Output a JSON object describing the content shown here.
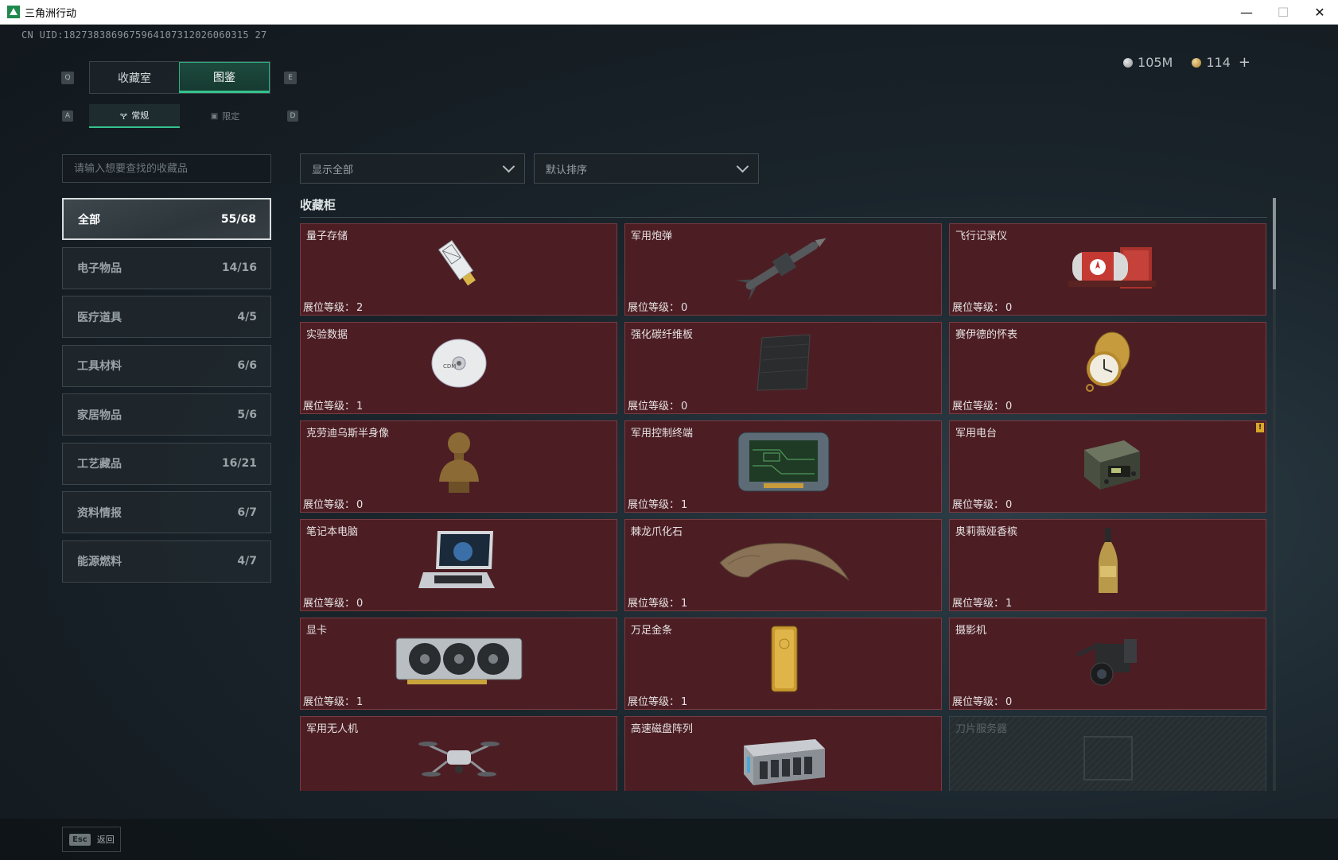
{
  "window": {
    "title": "三角洲行动",
    "controls": {
      "minimize": "—",
      "maximize": "☐",
      "close": "✕"
    }
  },
  "uid": "CN UID:1827383869675964107312026060315 27",
  "currency": [
    {
      "icon": "silver-coin-icon",
      "value": "105M"
    },
    {
      "icon": "gold-coin-icon",
      "value": "114"
    }
  ],
  "currency_add": "+",
  "keys": {
    "prev_tab": "Q",
    "next_tab": "E",
    "prev_sub": "A",
    "next_sub": "D"
  },
  "tabs": [
    {
      "label": "收藏室",
      "active": false
    },
    {
      "label": "图鉴",
      "active": true
    }
  ],
  "subtabs": [
    {
      "label": "常规",
      "icon": "bottle-icon",
      "active": true
    },
    {
      "label": "限定",
      "icon": "frame-icon",
      "active": false
    }
  ],
  "search": {
    "placeholder": "请输入想要查找的收藏品",
    "value": ""
  },
  "filters": {
    "display": "显示全部",
    "sort": "默认排序"
  },
  "categories": [
    {
      "label": "全部",
      "count": "55/68",
      "active": true
    },
    {
      "label": "电子物品",
      "count": "14/16",
      "active": false
    },
    {
      "label": "医疗道具",
      "count": "4/5",
      "active": false
    },
    {
      "label": "工具材料",
      "count": "6/6",
      "active": false
    },
    {
      "label": "家居物品",
      "count": "5/6",
      "active": false
    },
    {
      "label": "工艺藏品",
      "count": "16/21",
      "active": false
    },
    {
      "label": "资料情报",
      "count": "6/7",
      "active": false
    },
    {
      "label": "能源燃料",
      "count": "4/7",
      "active": false
    }
  ],
  "section_title": "收藏柜",
  "level_label": "展位等级：",
  "items": [
    {
      "name": "量子存储",
      "level": "2",
      "art": "usb-drive-icon"
    },
    {
      "name": "军用炮弹",
      "level": "0",
      "art": "missile-icon"
    },
    {
      "name": "飞行记录仪",
      "level": "0",
      "art": "flight-recorder-icon"
    },
    {
      "name": "实验数据",
      "level": "1",
      "art": "disc-icon"
    },
    {
      "name": "强化碳纤维板",
      "level": "0",
      "art": "carbon-plate-icon"
    },
    {
      "name": "赛伊德的怀表",
      "level": "0",
      "art": "pocket-watch-icon"
    },
    {
      "name": "克劳迪乌斯半身像",
      "level": "0",
      "art": "bust-icon"
    },
    {
      "name": "军用控制终端",
      "level": "1",
      "art": "control-terminal-icon"
    },
    {
      "name": "军用电台",
      "level": "0",
      "art": "radio-icon",
      "warning": "!"
    },
    {
      "name": "笔记本电脑",
      "level": "0",
      "art": "laptop-icon"
    },
    {
      "name": "棘龙爪化石",
      "level": "1",
      "art": "claw-fossil-icon"
    },
    {
      "name": "奥莉薇娅香槟",
      "level": "1",
      "art": "champagne-icon"
    },
    {
      "name": "显卡",
      "level": "1",
      "art": "gpu-icon"
    },
    {
      "name": "万足金条",
      "level": "1",
      "art": "gold-bar-icon"
    },
    {
      "name": "摄影机",
      "level": "0",
      "art": "camera-icon"
    },
    {
      "name": "军用无人机",
      "level": "",
      "art": "drone-icon"
    },
    {
      "name": "高速磁盘阵列",
      "level": "",
      "art": "disk-array-icon"
    },
    {
      "name": "刀片服务器",
      "level": "",
      "art": "blade-server-icon",
      "locked": true
    }
  ],
  "back": {
    "key": "Esc",
    "label": "返回"
  }
}
